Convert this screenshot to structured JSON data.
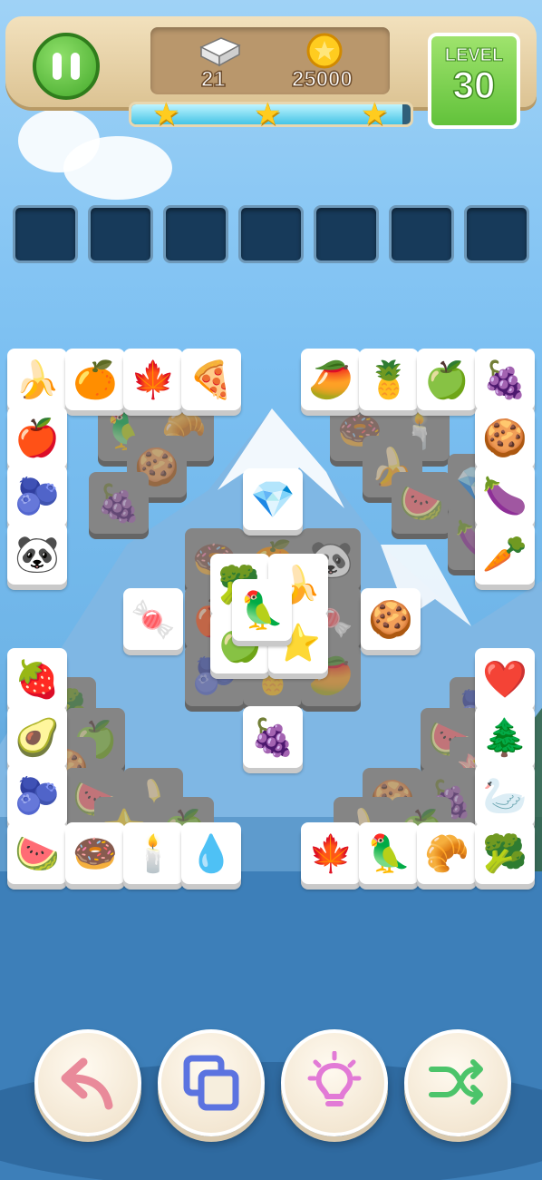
{
  "hud": {
    "pause_icon": "pause-icon",
    "tiles_count": "21",
    "coins": "25000",
    "level_label": "LEVEL",
    "level_number": "30",
    "progress_fraction": 0.97,
    "stars_earned": 3
  },
  "slots": {
    "count": 7
  },
  "tiles": [
    "banana",
    "orange",
    "leaf",
    "pizza",
    "apple",
    "blueberry",
    "panda",
    "mango",
    "pineapple",
    "green-apple",
    "grapes",
    "cookie",
    "eggplant",
    "carrot",
    "diamond",
    "candy",
    "broccoli",
    "banana",
    "toucan",
    "green-apple",
    "star",
    "cookie",
    "grapes",
    "strawberry",
    "avocado",
    "blueberry",
    "watermelon",
    "donut",
    "candle",
    "water-drop",
    "heart",
    "tree",
    "swan",
    "maple-leaf",
    "toucan",
    "croissant",
    "broccoli"
  ],
  "buttons": [
    "undo-button",
    "swap-button",
    "hint-button",
    "shuffle-button"
  ],
  "colors": {
    "accent_green": "#62c23b",
    "slot": "#173a5a",
    "star": "#ffcc1f"
  }
}
